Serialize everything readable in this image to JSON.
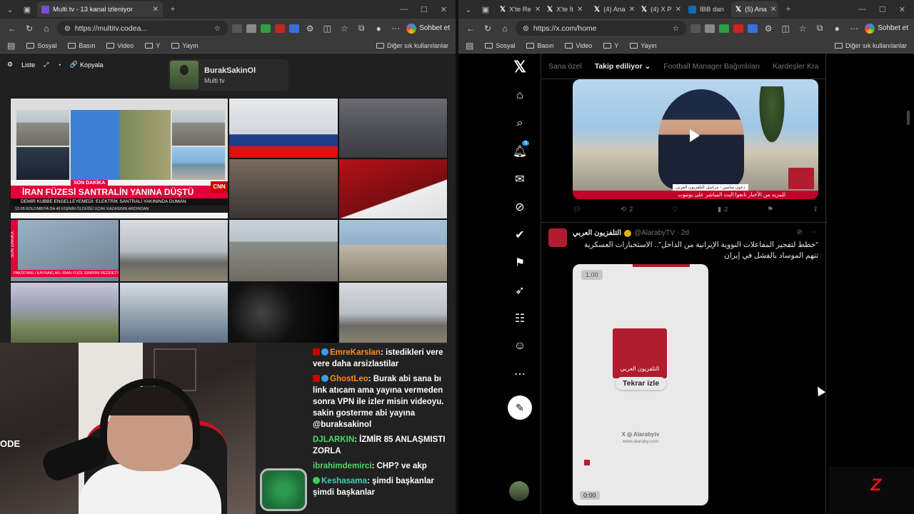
{
  "left_browser": {
    "tab_title": "Multi tv - 13 kanal izleniyor",
    "url": "https://multitv.codea...",
    "copilot": "Sohbet et",
    "bookmarks": [
      "Sosyal",
      "Basın",
      "Video",
      "Y",
      "Yayın"
    ],
    "bookmarks_right": "Diğer sık kullanılanlar"
  },
  "multitv": {
    "toolbar": {
      "list": "Liste",
      "copy": "Kopyala"
    },
    "profile": {
      "name": "BurakSakinOl",
      "sub": "Multi tv"
    },
    "news": {
      "breaking": "SON DAKİKA",
      "headline": "İRAN FÜZESİ SANTRALİN YANINA DÜŞTÜ",
      "sub": "DEMİR KUBBE ENGELLEYEMEDİ: ELEKTRİK SANTRALİ YAKININDA DUMAN",
      "sub2": "13.05 KOLOMBIYA DA 49 KİŞİNİN ÖLDÜĞÜ UÇAK KAZASININ ARDINDAN",
      "cnn": "CNN",
      "bar2": "PAKİSTANLI KAYNAKLAR: İRAN FÜZE SINIRINI REDDETTİ",
      "vertical": "SON DAKİKA"
    }
  },
  "chat": [
    {
      "user": "EmreKarslan",
      "text": "istedikleri vere vere daha arsizlastilar",
      "color": "orange"
    },
    {
      "user": "GhostLeo",
      "text": "Burak abi sana bı link atıcam ama yayına vermeden sonra VPN ile izler misin videoyu. sakin gosterme abi yayına @buraksakinol",
      "color": "orange"
    },
    {
      "user": "DJLARKIN",
      "text": "İZMİR 85 ANLAŞMISTI ZORLA",
      "color": "green"
    },
    {
      "user": "ibrahimdemirci",
      "text": "CHP? ve akp",
      "color": "green"
    },
    {
      "user": "Keshasama",
      "text": "şimdi başkanlar şimdi başkanlar",
      "color": "teal"
    }
  ],
  "webcam": {
    "brand": "ODE"
  },
  "right_browser": {
    "tabs": [
      "X'te Re",
      "X'te İt",
      "(4) Ana",
      "(4) X P",
      "İBB dan",
      "(5) Ana"
    ],
    "url": "https://x.com/home",
    "copilot": "Sohbet et",
    "bookmarks": [
      "Sosyal",
      "Basın",
      "Video",
      "Y",
      "Yayın"
    ],
    "bookmarks_right": "Diğer sık kullanılanlar"
  },
  "x": {
    "tabs": [
      "Sana özel",
      "Takip ediliyor",
      "Football Manager Bağımlıları",
      "Kardeşler Kra"
    ],
    "active_tab": "Takip ediliyor",
    "notification_count": "5",
    "post1": {
      "ticker": "للمزيد من الأخبار تابعوا البث المباشر على يوتيوب",
      "nametag": "دعون سامين - مراسل التلفزيون العربي",
      "retweets": "2",
      "views": "2"
    },
    "post2": {
      "name": "التلفزيون العربي",
      "handle": "@AlarabyTV · 2d",
      "text": "\"خطط لتفجير المفاعلات النووية الإيرانية من الداخل\".. الاستخبارات العسكرية تتهم الموساد بالفشل في إيران",
      "speed": "1.00",
      "logo_text": "التلفزيون العربي",
      "replay": "Tekrar izle",
      "watermark": "X ◎ Alarabytv",
      "site": "www.alaraby.com",
      "time": "0:00"
    }
  }
}
